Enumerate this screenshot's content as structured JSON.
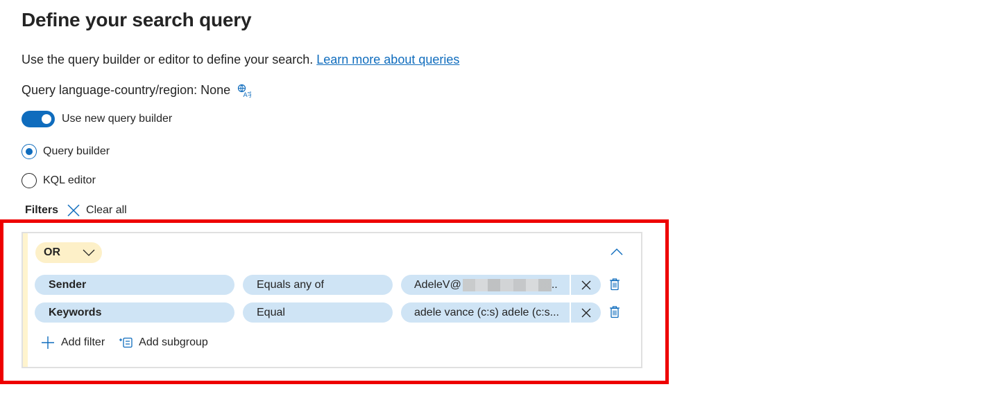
{
  "page": {
    "title": "Define your search query",
    "description": "Use the query builder or editor to define your search.",
    "learn_more_link": "Learn more about queries",
    "language_label": "Query language-country/region: None",
    "language_icon": "translate-icon"
  },
  "toggle": {
    "label": "Use new query builder",
    "on": true
  },
  "mode_options": [
    {
      "label": "Query builder",
      "selected": true
    },
    {
      "label": "KQL editor",
      "selected": false
    }
  ],
  "filters": {
    "label": "Filters",
    "clear_all": "Clear all"
  },
  "group": {
    "operator": "OR",
    "rows": [
      {
        "field": "Sender",
        "condition": "Equals any of",
        "value": "AdeleV@",
        "value_suffix": "..",
        "value_redacted": true
      },
      {
        "field": "Keywords",
        "condition": "Equal",
        "value": "adele vance (c:s) adele (c:s...",
        "value_suffix": "",
        "value_redacted": false
      }
    ],
    "add_filter": "Add filter",
    "add_subgroup": "Add subgroup"
  },
  "colors": {
    "accent": "#0f6cbd",
    "pill": "#cfe4f5",
    "or_pill": "#fdf0c8",
    "highlight_frame": "#ee0000"
  }
}
